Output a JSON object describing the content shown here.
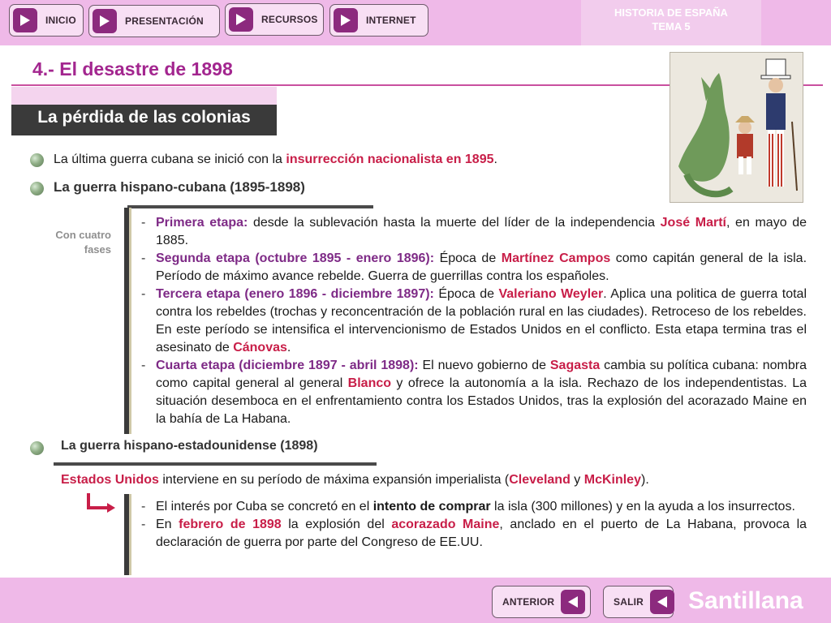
{
  "nav": {
    "inicio": "INICIO",
    "presentacion": "PRESENTACIÓN",
    "recursos": "RECURSOS",
    "internet": "INTERNET",
    "tema_line1": "HISTORIA DE ESPAÑA",
    "tema_line2": "TEMA 5",
    "play_icon": "play-triangle-icon"
  },
  "header": {
    "title": "4.- El desastre de 1898",
    "section": "La pérdida de las colonias"
  },
  "intro": {
    "runs": [
      {
        "t": "La última guerra cubana se inició con la ",
        "s": ""
      },
      {
        "t": "insurrección nacionalista en 1895",
        "s": "r"
      },
      {
        "t": ".",
        "s": ""
      }
    ]
  },
  "cuban_war": {
    "heading": "La guerra hispano-cubana (1895-1898)",
    "side_label": "Con cuatro fases",
    "phases": [
      [
        {
          "t": "Primera etapa:",
          "s": "pu"
        },
        {
          "t": " desde la sublevación hasta la muerte del líder de la independencia ",
          "s": ""
        },
        {
          "t": "José Martí",
          "s": "r"
        },
        {
          "t": ", en mayo de 1885.",
          "s": ""
        }
      ],
      [
        {
          "t": "Segunda etapa (octubre 1895 - enero 1896):",
          "s": "pu"
        },
        {
          "t": "  Época de ",
          "s": ""
        },
        {
          "t": "Martínez Campos",
          "s": "r"
        },
        {
          "t": " como capitán general de la isla. Período de máximo avance rebelde. Guerra de guerrillas contra los españoles.",
          "s": ""
        }
      ],
      [
        {
          "t": "Tercera etapa (enero 1896 - diciembre 1897):",
          "s": "pu"
        },
        {
          "t": " Época de ",
          "s": ""
        },
        {
          "t": "Valeriano Weyler",
          "s": "r"
        },
        {
          "t": ". Aplica una politica de guerra total contra los rebeldes (trochas y reconcentración de la población rural en las ciudades). Retroceso de los rebeldes. En este período se intensifica el intervencionismo de Estados Unidos en el conflicto.  Esta etapa termina tras el asesinato de ",
          "s": ""
        },
        {
          "t": "Cánovas",
          "s": "r"
        },
        {
          "t": ".",
          "s": ""
        }
      ],
      [
        {
          "t": "Cuarta etapa (diciembre 1897 - abril 1898):",
          "s": "pu"
        },
        {
          "t": " El nuevo gobierno de ",
          "s": ""
        },
        {
          "t": "Sagasta",
          "s": "r"
        },
        {
          "t": " cambia su política cubana: nombra como capital general al general ",
          "s": ""
        },
        {
          "t": "Blanco",
          "s": "r"
        },
        {
          "t": " y ofrece la autonomía a la isla. Rechazo de los independentistas. La situación desemboca en el enfrentamiento contra los Estados Unidos, tras la explosión del acorazado Maine en la bahía de La Habana.",
          "s": ""
        }
      ]
    ]
  },
  "us_war": {
    "heading": "La guerra hispano-estadounidense (1898)",
    "lead": [
      {
        "t": "Estados Unidos",
        "s": "r"
      },
      {
        "t": " interviene en su período de máxima expansión imperialista (",
        "s": ""
      },
      {
        "t": "Cleveland",
        "s": "r"
      },
      {
        "t": " y ",
        "s": ""
      },
      {
        "t": "McKinley",
        "s": "r"
      },
      {
        "t": ").",
        "s": ""
      }
    ],
    "points": [
      [
        {
          "t": "El interés por Cuba se concretó en el ",
          "s": ""
        },
        {
          "t": "intento de comprar",
          "s": "b"
        },
        {
          "t": " la isla (300 millones) y en la ayuda a los insurrectos.",
          "s": ""
        }
      ],
      [
        {
          "t": "En ",
          "s": ""
        },
        {
          "t": "febrero de 1898",
          "s": "r"
        },
        {
          "t": " la explosión del ",
          "s": ""
        },
        {
          "t": "acorazado Maine",
          "s": "r"
        },
        {
          "t": ", anclado en el puerto de La Habana, provoca la declaración de guerra por parte del Congreso de EE.UU.",
          "s": ""
        }
      ]
    ]
  },
  "footer": {
    "anterior": "ANTERIOR",
    "salir": "SALIR",
    "brand": "Santillana",
    "back_icon": "back-triangle-icon"
  }
}
